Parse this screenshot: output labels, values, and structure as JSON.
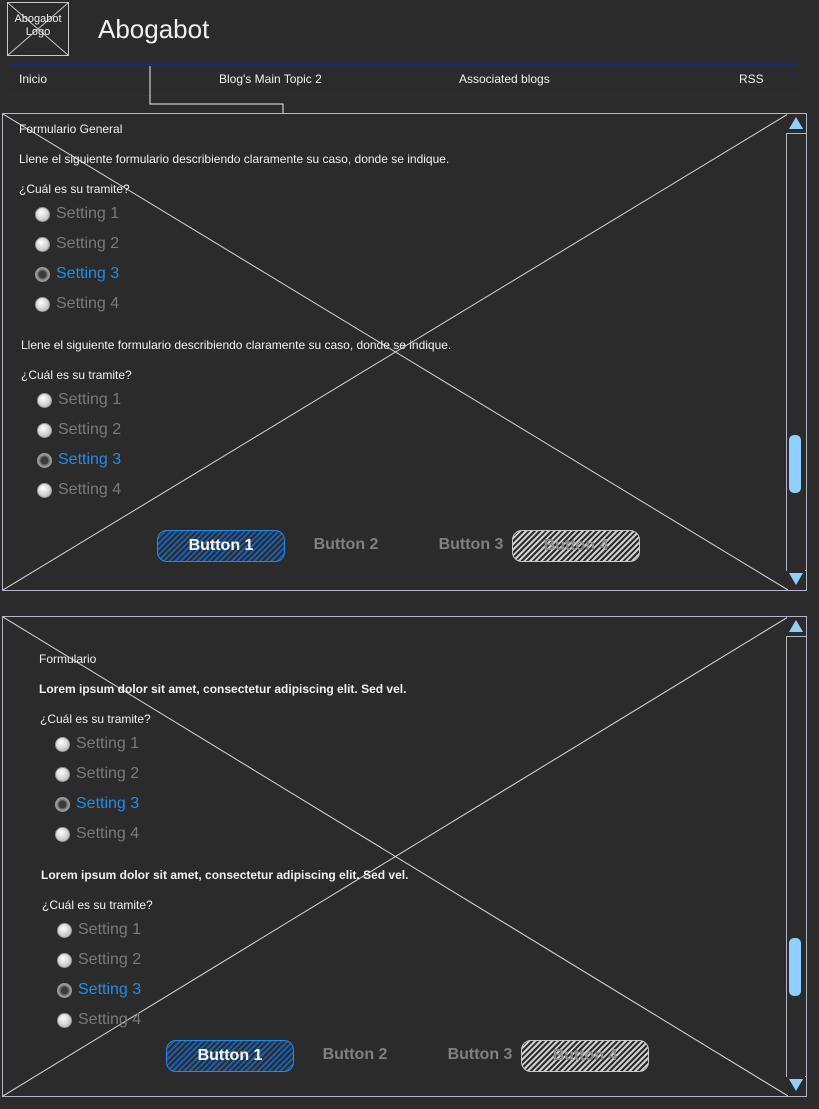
{
  "header": {
    "logo_text": "Abogabot Logo",
    "title": "Abogabot"
  },
  "nav": {
    "items": [
      "Inicio",
      "Blog's Main Topic 2",
      "Associated blogs",
      "RSS"
    ]
  },
  "panel1": {
    "title": "Formulario General",
    "section1": {
      "description": "Llene el siguiente formulario describiendo claramente su caso, donde se indique.",
      "question": "¿Cuál es su tramite?",
      "options": [
        "Setting 1",
        "Setting 2",
        "Setting 3",
        "Setting 4"
      ],
      "selected": "Setting 3"
    },
    "section2": {
      "description": "Llene el siguiente formulario describiendo claramente su caso, donde se indique.",
      "question": "¿Cuál es su tramite?",
      "options": [
        "Setting 1",
        "Setting 2",
        "Setting 3",
        "Setting 4"
      ],
      "selected": "Setting 3"
    },
    "buttons": [
      "Button 1",
      "Button 2",
      "Button 3",
      "Button 4"
    ]
  },
  "panel2": {
    "title": "Formulario",
    "section1": {
      "description": "Lorem ipsum dolor sit amet, consectetur adipiscing elit. Sed vel.",
      "question": "¿Cuál es su tramite?",
      "options": [
        "Setting 1",
        "Setting 2",
        "Setting 3",
        "Setting 4"
      ],
      "selected": "Setting 3"
    },
    "section2": {
      "description": "Lorem ipsum dolor sit amet, consectetur adipiscing elit. Sed vel.",
      "question": "¿Cuál es su tramite?",
      "options": [
        "Setting 1",
        "Setting 2",
        "Setting 3",
        "Setting 4"
      ],
      "selected": "Setting 3"
    },
    "buttons": [
      "Button 1",
      "Button 2",
      "Button 3",
      "Button 4"
    ]
  },
  "colors": {
    "background": "#2b2b2b",
    "accent": "#1e8ee8",
    "scroll_thumb": "#8fd0ff",
    "nav_border": "#1b2b86"
  },
  "icons": {
    "logo": "image-placeholder-icon",
    "scroll_up": "arrow-up-icon",
    "scroll_down": "arrow-down-icon"
  }
}
